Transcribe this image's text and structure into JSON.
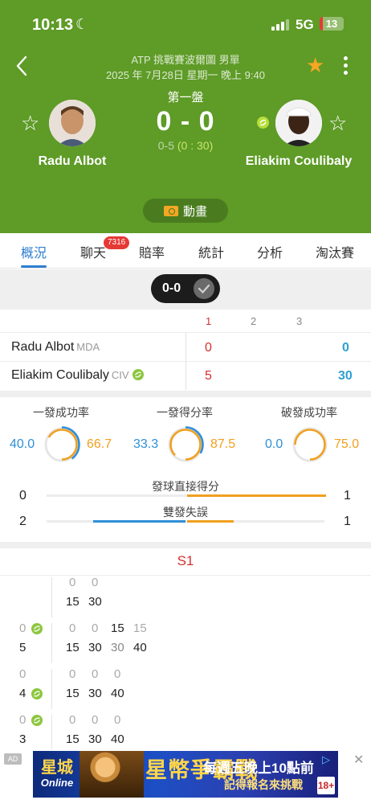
{
  "status_bar": {
    "time": "10:13",
    "network": "5G",
    "battery": "13",
    "battery_level": 0.13
  },
  "header": {
    "event": "ATP 挑戰賽波爾圖 男單",
    "datetime": "2025 年 7月28日 星期一 晚上 9:40",
    "set_label": "第一盤",
    "score": "0 - 0",
    "game_score": "0-5",
    "point_score": "(0 : 30)",
    "player1": "Radu Albot",
    "player2": "Eliakim Coulibaly",
    "animation_label": "動畫"
  },
  "tabs": [
    {
      "label": "概況",
      "active": true
    },
    {
      "label": "聊天",
      "badge": "7316"
    },
    {
      "label": "賠率"
    },
    {
      "label": "統計"
    },
    {
      "label": "分析"
    },
    {
      "label": "淘汰賽"
    }
  ],
  "scoreboard": {
    "toggle_label": "0-0",
    "set_headers": [
      "1",
      "2",
      "3"
    ],
    "players": [
      {
        "name": "Radu Albot",
        "code": "MDA",
        "serving": false,
        "set1": "0",
        "points": "0"
      },
      {
        "name": "Eliakim Coulibaly",
        "code": "CIV",
        "serving": true,
        "set1": "5",
        "points": "30"
      }
    ]
  },
  "stats": {
    "rings": [
      {
        "title": "一發成功率",
        "left": "40.0",
        "right": "66.7",
        "left_frac": 0.4,
        "right_frac": 0.667
      },
      {
        "title": "一發得分率",
        "left": "33.3",
        "right": "87.5",
        "left_frac": 0.333,
        "right_frac": 0.875
      },
      {
        "title": "破發成功率",
        "left": "0.0",
        "right": "75.0",
        "left_frac": 0.0,
        "right_frac": 0.75
      }
    ],
    "bars": [
      {
        "title": "發球直接得分",
        "left": "0",
        "right": "1",
        "left_value": 0,
        "right_value": 1
      },
      {
        "title": "雙發失誤",
        "left": "2",
        "right": "1",
        "left_value": 2,
        "right_value": 1
      }
    ]
  },
  "point_by_point": {
    "set_label": "S1",
    "games": [
      {
        "top_score": "",
        "bottom_score": "",
        "top_check": false,
        "bottom_check": false,
        "top": [
          "0",
          "0"
        ],
        "bottom": [
          "15",
          "30"
        ]
      },
      {
        "top_score": "0",
        "bottom_score": "5",
        "top_check": true,
        "bottom_check": false,
        "top": [
          "0",
          "0",
          "15",
          "15"
        ],
        "bottom": [
          "15",
          "30",
          "30",
          "40"
        ]
      },
      {
        "top_score": "0",
        "bottom_score": "4",
        "top_check": false,
        "bottom_check": true,
        "top": [
          "0",
          "0",
          "0"
        ],
        "bottom": [
          "15",
          "30",
          "40"
        ]
      },
      {
        "top_score": "0",
        "bottom_score": "3",
        "top_check": true,
        "bottom_check": false,
        "top": [
          "0",
          "0",
          "0"
        ],
        "bottom": [
          "15",
          "30",
          "40"
        ]
      }
    ]
  },
  "ad": {
    "tag": "AD",
    "logo_top": "星城",
    "logo_bottom": "Online",
    "title": "星幣爭霸戰",
    "line1": "每週五晚上10點前",
    "line2": "記得報名來挑戰",
    "age": "18+"
  },
  "colors": {
    "header_green": "#5e9b27",
    "accent_blue": "#2f7fd1",
    "accent_orange": "#f0a020",
    "set_red": "#d32f2f",
    "serve_green": "#8cc63f"
  }
}
